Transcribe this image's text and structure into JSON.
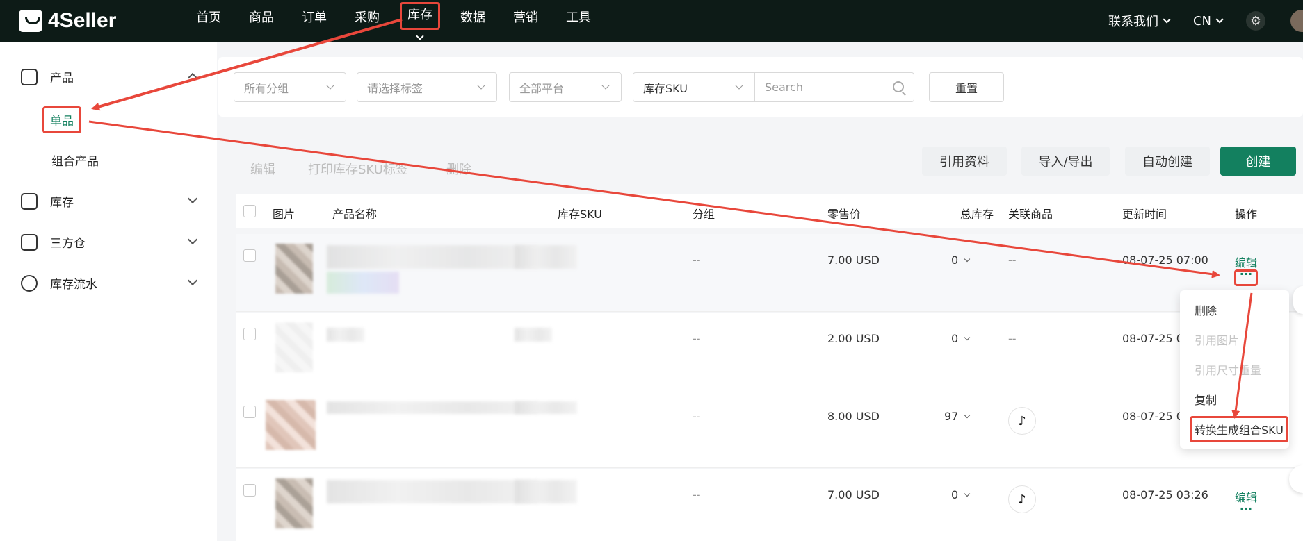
{
  "brand": {
    "name": "4Seller"
  },
  "nav": {
    "items": [
      "首页",
      "商品",
      "订单",
      "采购",
      "库存",
      "数据",
      "营销",
      "工具"
    ],
    "active": "库存"
  },
  "topright": {
    "contact": "联系我们",
    "lang": "CN"
  },
  "sidebar": {
    "product": "产品",
    "single": "单品",
    "combo": "组合产品",
    "inventory": "库存",
    "thirdparty": "三方仓",
    "flow": "库存流水"
  },
  "filters": {
    "group": "所有分组",
    "tag": "请选择标签",
    "platform": "全部平台",
    "sku_type": "库存SKU",
    "search_placeholder": "Search",
    "reset": "重置"
  },
  "actions": {
    "edit": "编辑",
    "print": "打印库存SKU标签",
    "delete": "删除",
    "ref": "引用资料",
    "import": "导入/导出",
    "auto": "自动创建",
    "create": "创建"
  },
  "columns": [
    "图片",
    "产品名称",
    "库存SKU",
    "分组",
    "零售价",
    "总库存",
    "关联商品",
    "更新时间",
    "操作"
  ],
  "rows": [
    {
      "group": "--",
      "price": "7.00 USD",
      "stock": "0",
      "linked": "--",
      "time": "08-07-25 07:00",
      "op": "编辑"
    },
    {
      "group": "--",
      "price": "2.00 USD",
      "stock": "0",
      "linked": "--",
      "time": "08-07-25 0",
      "op": ""
    },
    {
      "group": "--",
      "price": "8.00 USD",
      "stock": "97",
      "linked": "",
      "time": "08-07-25 0",
      "op": ""
    },
    {
      "group": "--",
      "price": "7.00 USD",
      "stock": "0",
      "linked": "",
      "time": "08-07-25 03:26",
      "op": "编辑"
    }
  ],
  "menu": {
    "delete": "删除",
    "ref_image": "引用图片",
    "ref_size": "引用尺寸重量",
    "copy": "复制",
    "convert": "转换生成组合SKU"
  },
  "colors": {
    "brand_green": "#13805f",
    "topbar": "#0d1b17",
    "annotation_red": "#e8473b"
  },
  "more_glyph": "···"
}
